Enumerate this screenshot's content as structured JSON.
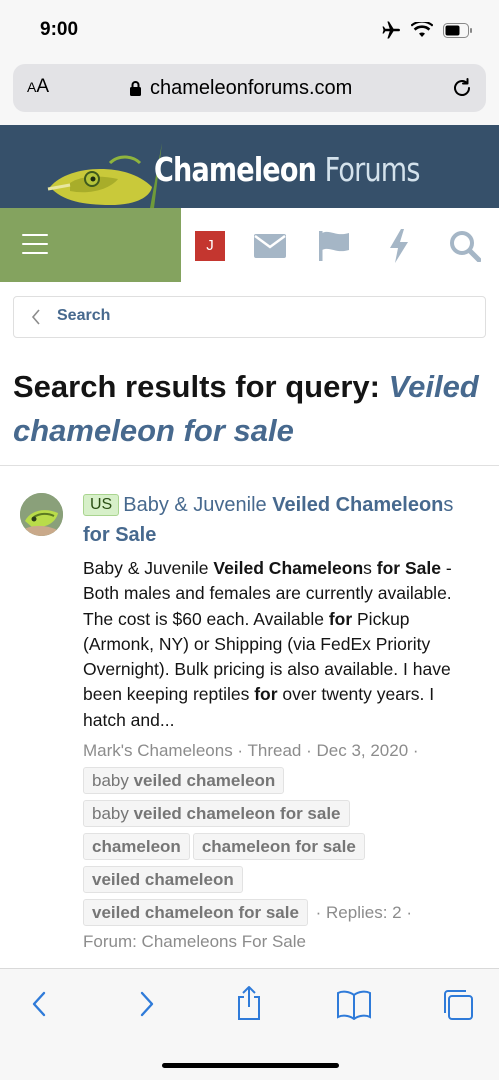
{
  "status": {
    "time": "9:00"
  },
  "browser": {
    "aa_label_big": "A",
    "aa_label_small": "A",
    "url": "chameleonforums.com"
  },
  "site": {
    "logo_main": "Chameleon",
    "logo_sub": "Forums"
  },
  "nav": {
    "user_initial": "J"
  },
  "breadcrumb": {
    "label": "Search"
  },
  "page": {
    "title_prefix": "Search results for query: ",
    "query": "Veiled chameleon for sale"
  },
  "result": {
    "badge": "US",
    "title_plain": "Baby & Juvenile ",
    "title_bold1": "Veiled",
    "title_bold2": "Chameleon",
    "title_plain2": "s ",
    "title_bold3": "for Sale",
    "snippet": {
      "s1": "Baby & Juvenile ",
      "b1": "Veiled Chameleon",
      "s2": "s ",
      "b2": "for Sale",
      "s3": " - Both males and females are currently available. The cost is $60 each. Available ",
      "b3": "for",
      "s4": " Pickup (Armonk, NY) or Shipping (via FedEx Priority Overnight). Bulk pricing is also available. I have been keeping reptiles ",
      "b4": "for",
      "s5": " over twenty years. I hatch and..."
    },
    "author": "Mark's Chameleons",
    "type": "Thread",
    "date": "Dec 3, 2020",
    "tags": [
      {
        "plain": "baby ",
        "bold": "veiled chameleon"
      },
      {
        "plain": "baby ",
        "bold": "veiled chameleon for sale"
      },
      {
        "plain": "",
        "bold": "chameleon"
      },
      {
        "plain": "",
        "bold": "chameleon for sale"
      },
      {
        "plain": "",
        "bold": "veiled chameleon"
      },
      {
        "plain": "",
        "bold": "veiled chameleon for sale"
      }
    ],
    "replies": "Replies: 2",
    "forum": "Forum: Chameleons For Sale"
  },
  "colors": {
    "header_bg": "#36506a",
    "menu_green": "#84a35f",
    "link_blue": "#47698e",
    "user_red": "#c4362f",
    "ios_blue": "#2f7bd9"
  },
  "icons": [
    "airplane-icon",
    "wifi-icon",
    "battery-icon",
    "lock-icon",
    "reload-icon",
    "hamburger-icon",
    "envelope-icon",
    "flag-icon",
    "bolt-icon",
    "search-icon",
    "chevron-left-icon",
    "back-icon",
    "forward-icon",
    "share-icon",
    "bookmarks-icon",
    "tabs-icon"
  ]
}
